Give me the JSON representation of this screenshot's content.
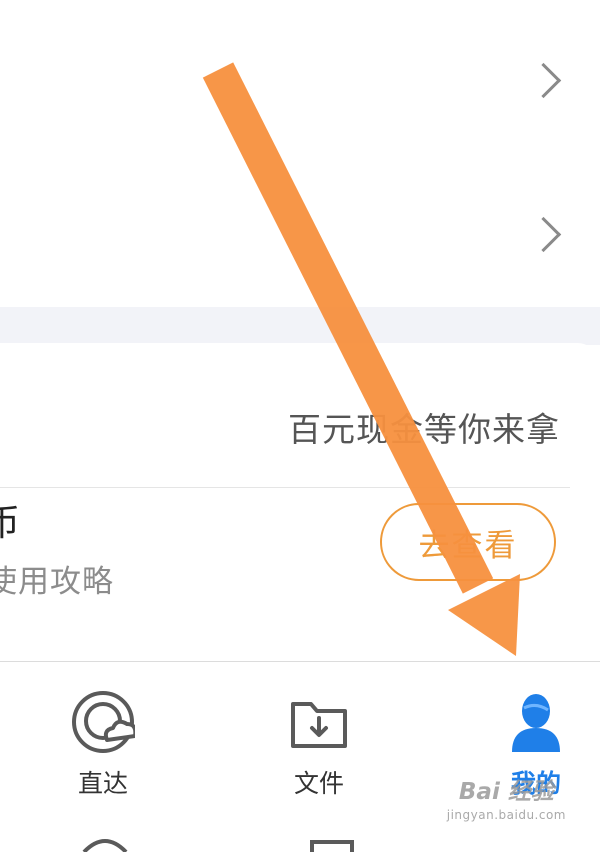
{
  "rows": [
    {
      "label": ""
    },
    {
      "label": ""
    }
  ],
  "promo": {
    "text": "百元现金等你来拿"
  },
  "coin_card": {
    "title": "币",
    "subtitle": "使用攻略",
    "button_label": "去查看"
  },
  "tabbar": {
    "items": [
      {
        "label": "直达",
        "icon": "direct-icon",
        "active": false
      },
      {
        "label": "文件",
        "icon": "folder-download-icon",
        "active": false
      },
      {
        "label": "我的",
        "icon": "user-icon",
        "active": true
      }
    ]
  },
  "watermark": {
    "main": "Bai 经验",
    "sub": "jingyan.baidu.com"
  },
  "colors": {
    "accent_blue": "#1f7fe8",
    "button_orange": "#ee9a3a",
    "annotation_arrow": "#f7913f",
    "band_gray": "#f2f3f8"
  }
}
